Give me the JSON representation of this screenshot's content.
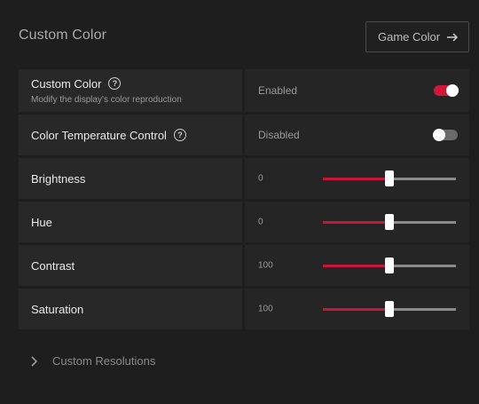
{
  "header": {
    "title": "Custom Color",
    "game_color_label": "Game Color"
  },
  "rows": [
    {
      "label": "Custom Color",
      "sublabel": "Modify the display's color reproduction",
      "status": "Enabled",
      "toggle": true
    },
    {
      "label": "Color Temperature Control",
      "status": "Disabled",
      "toggle": false
    },
    {
      "label": "Brightness",
      "value": "0",
      "fraction": 0.5
    },
    {
      "label": "Hue",
      "value": "0",
      "fraction": 0.5
    },
    {
      "label": "Contrast",
      "value": "100",
      "fraction": 0.5
    },
    {
      "label": "Saturation",
      "value": "100",
      "fraction": 0.5
    }
  ],
  "footer": {
    "custom_resolutions_label": "Custom Resolutions"
  },
  "colors": {
    "accent": "#d0173a",
    "background": "#1e1e1e"
  },
  "icons": {
    "help": "question-circle-icon",
    "arrow": "arrow-right-icon",
    "chevron": "chevron-right-icon"
  }
}
